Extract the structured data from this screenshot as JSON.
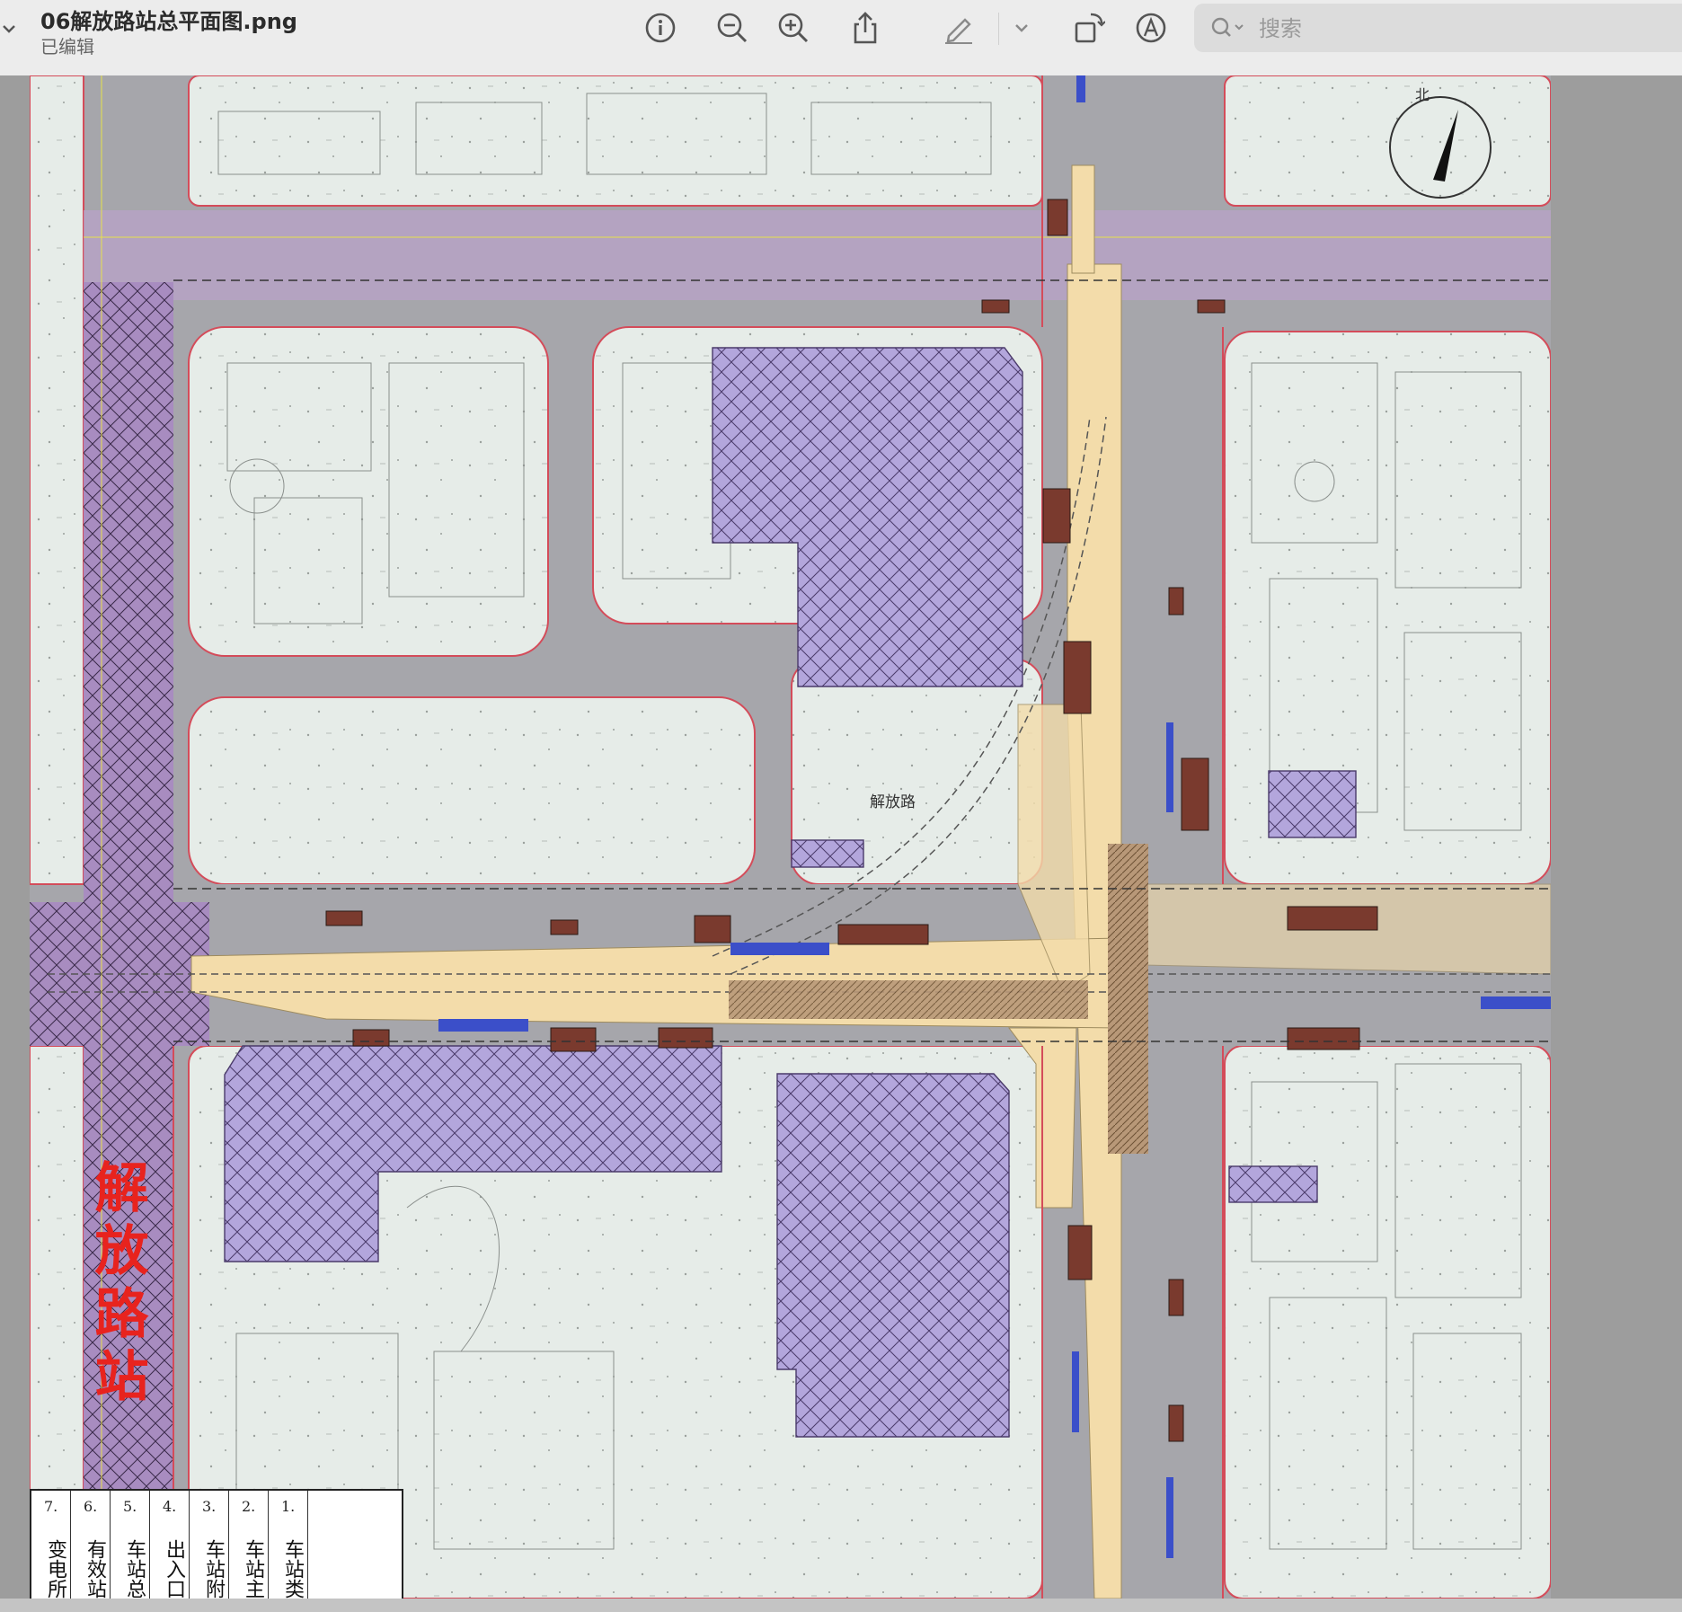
{
  "toolbar": {
    "file_name": "06解放路站总平面图.png",
    "status": "已编辑",
    "search_placeholder": "搜索",
    "icons": [
      "chevron-down-icon",
      "info-icon",
      "zoom-out-icon",
      "zoom-in-icon",
      "share-icon",
      "markup-pen-icon",
      "chevron-down-icon",
      "rotate-icon",
      "markup-icon",
      "search-icon"
    ]
  },
  "map": {
    "station_name": "解放路站",
    "road_label": "解放路",
    "north_label": "北"
  },
  "legend": {
    "items": [
      {
        "num": "1.",
        "text": "车站类"
      },
      {
        "num": "2.",
        "text": "车站主"
      },
      {
        "num": "3.",
        "text": "车站附"
      },
      {
        "num": "4.",
        "text": "出入口"
      },
      {
        "num": "5.",
        "text": "车站总"
      },
      {
        "num": "6.",
        "text": "有效站"
      },
      {
        "num": "7.",
        "text": "变电所"
      }
    ]
  },
  "colors": {
    "road": "#a6a6ab",
    "block": "#e6ece8",
    "station": "#f3dcaa",
    "hatch": "#b3a6dc",
    "road_purple": "#a88cc0",
    "boundary": "#d44c5a",
    "label_red": "#e8231e"
  }
}
